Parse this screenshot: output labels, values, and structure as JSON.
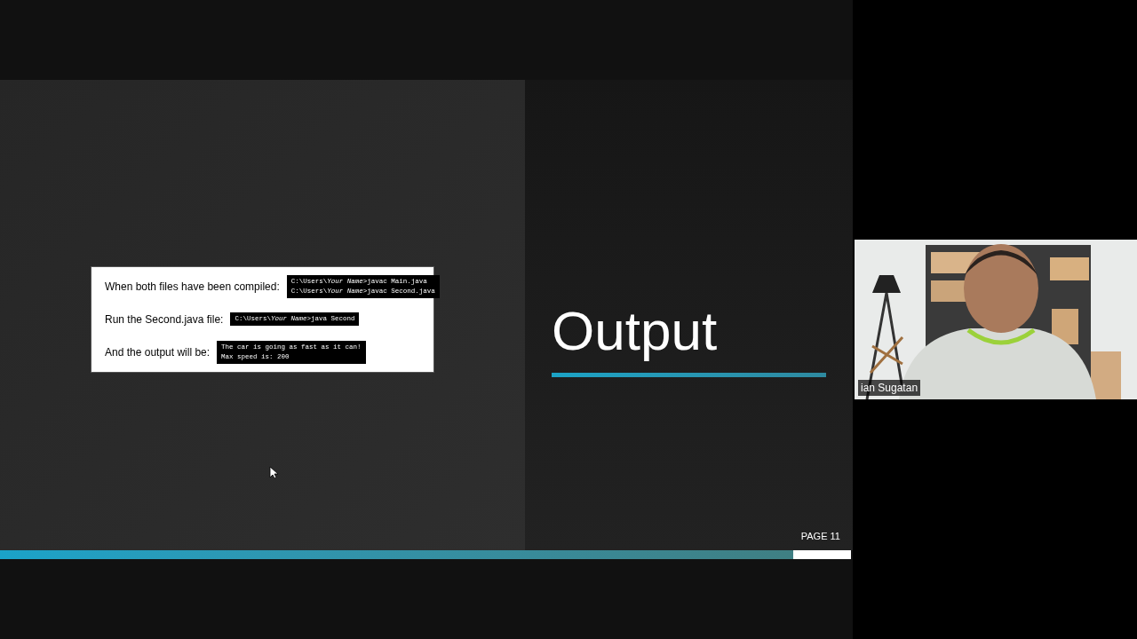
{
  "slide": {
    "steps": [
      {
        "label": "When both files have been compiled:",
        "code": [
          "C:\\Users\\*Your Name*>javac Main.java",
          "C:\\Users\\*Your Name*>javac Second.java"
        ]
      },
      {
        "label": "Run the Second.java file:",
        "code": [
          "C:\\Users\\*Your Name*>java Second"
        ]
      },
      {
        "label": "And the output will be:",
        "code": [
          "The car is going as fast as it can!",
          "Max speed is: 200"
        ]
      }
    ],
    "title": "Output",
    "page": "PAGE 11",
    "progress": {
      "level": 0.932
    }
  },
  "video": {
    "kind": "picture",
    "name": "ian Sugatan"
  }
}
